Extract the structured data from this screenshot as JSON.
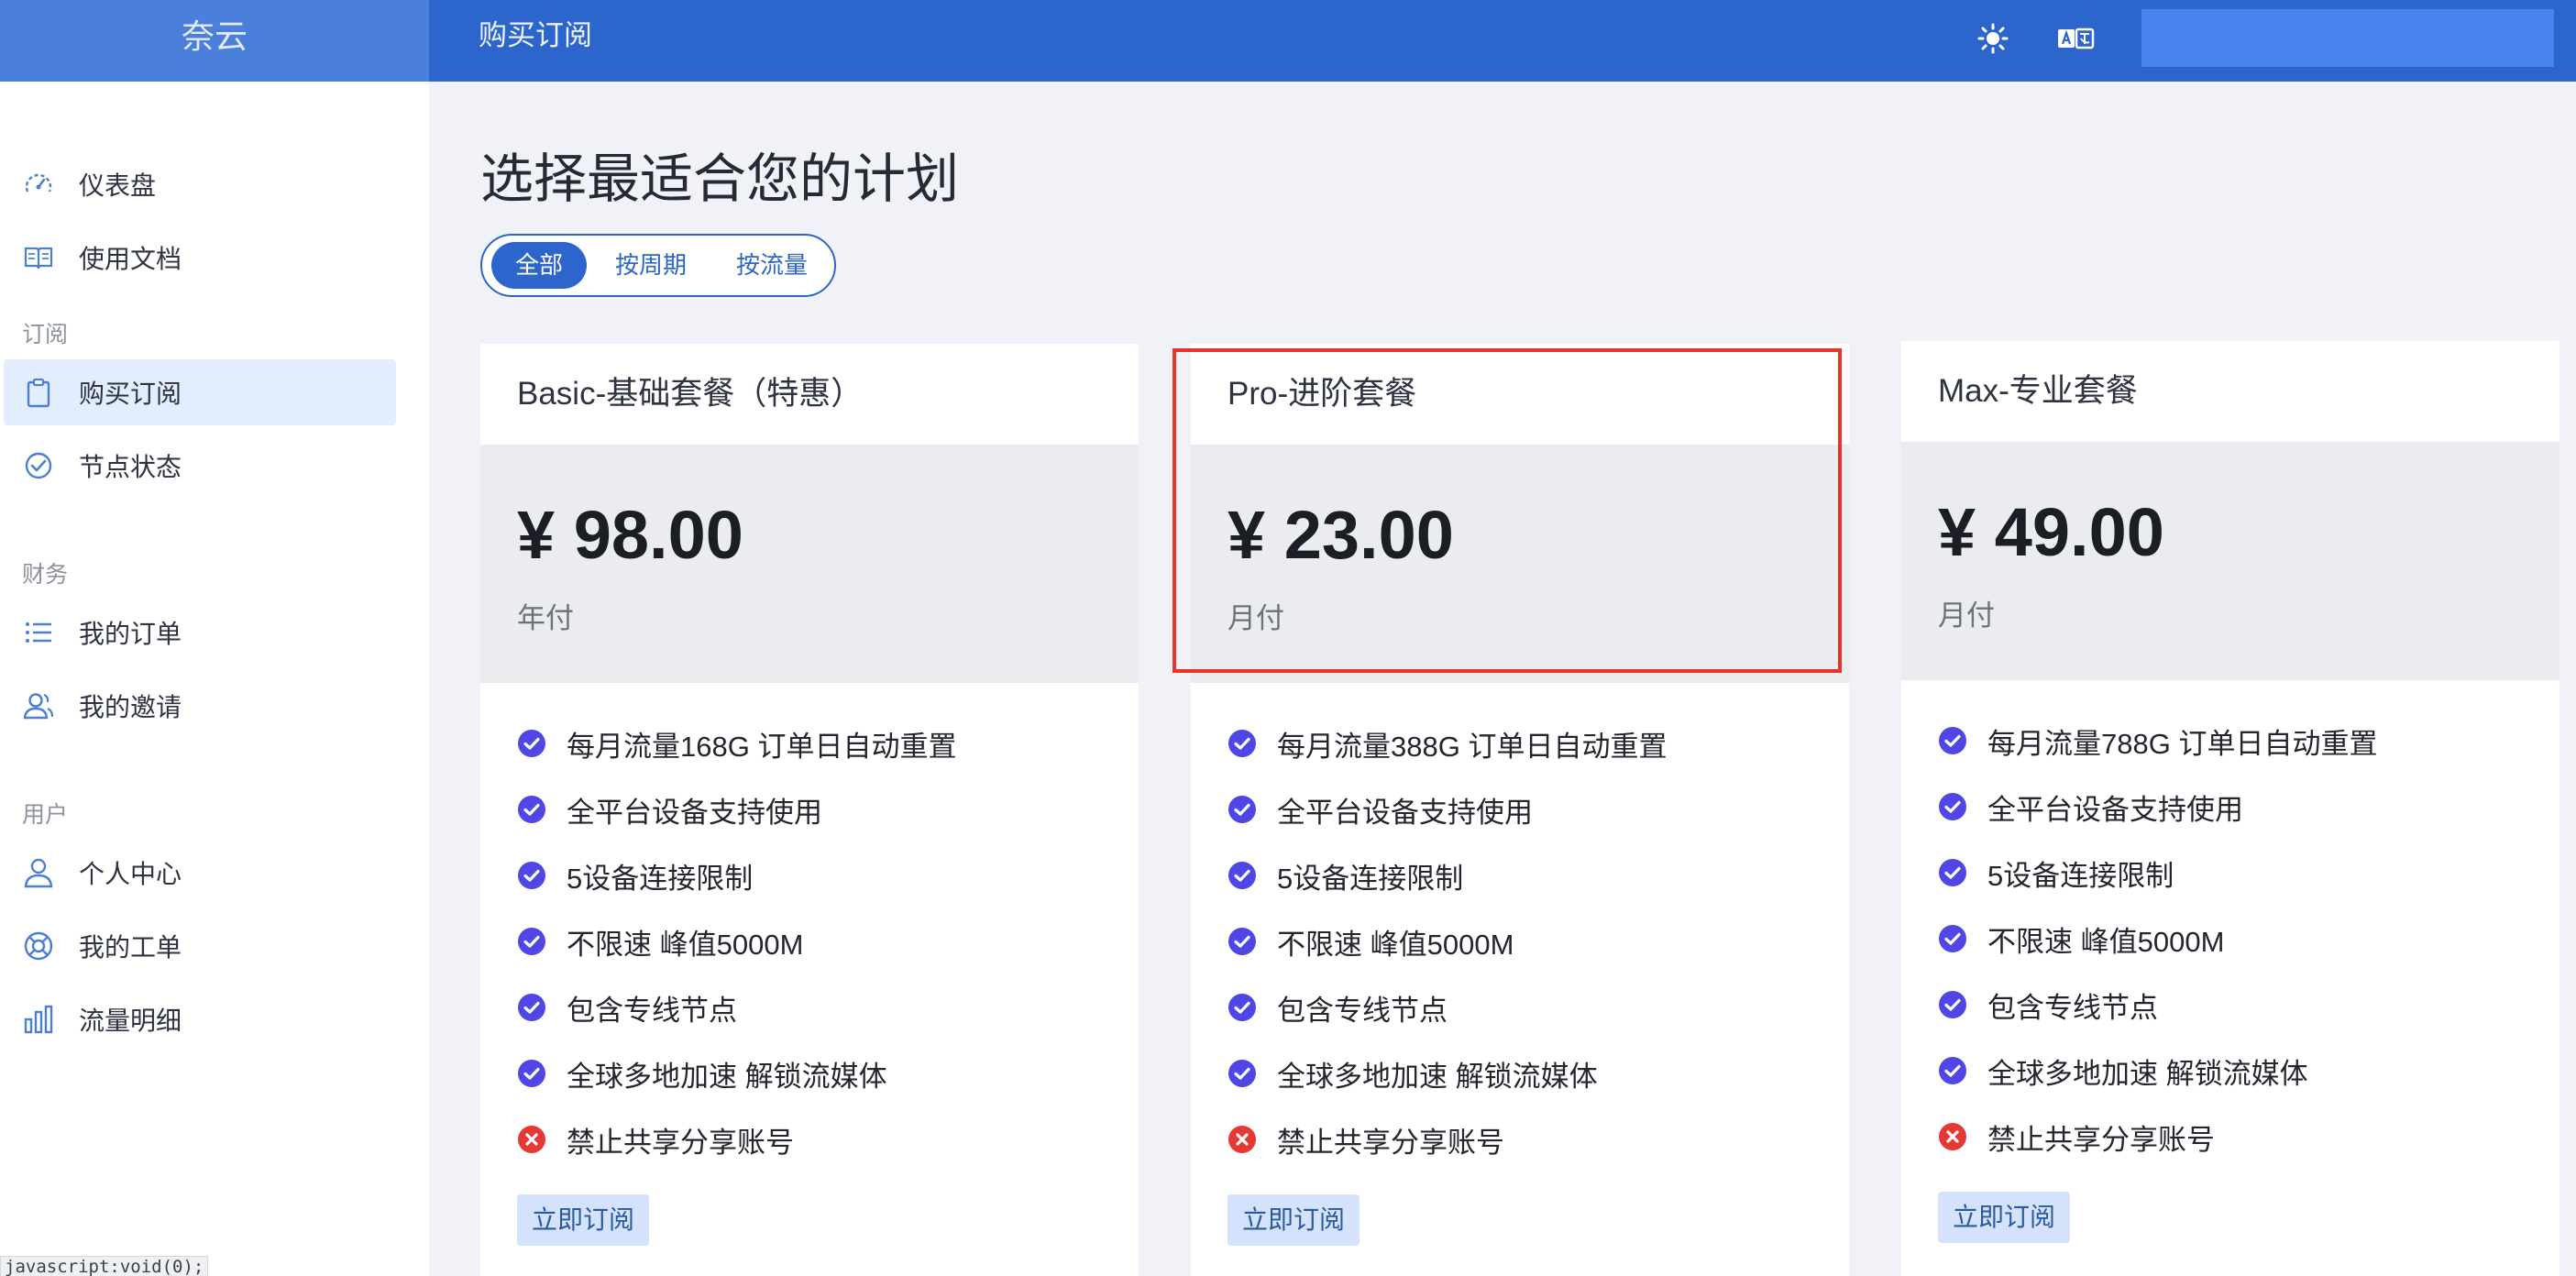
{
  "header": {
    "brand": "奈云",
    "page_title": "购买订阅"
  },
  "sidebar": {
    "items_top": [
      {
        "label": "仪表盘",
        "icon": "gauge-icon"
      },
      {
        "label": "使用文档",
        "icon": "book-icon"
      }
    ],
    "groups": [
      {
        "title": "订阅",
        "items": [
          {
            "label": "购买订阅",
            "icon": "clipboard-icon",
            "active": true
          },
          {
            "label": "节点状态",
            "icon": "check-circle-icon"
          }
        ]
      },
      {
        "title": "财务",
        "items": [
          {
            "label": "我的订单",
            "icon": "list-icon"
          },
          {
            "label": "我的邀请",
            "icon": "user-group-icon"
          }
        ]
      },
      {
        "title": "用户",
        "items": [
          {
            "label": "个人中心",
            "icon": "user-icon"
          },
          {
            "label": "我的工单",
            "icon": "lifebuoy-icon"
          },
          {
            "label": "流量明细",
            "icon": "bar-chart-icon"
          }
        ]
      }
    ]
  },
  "main": {
    "title": "选择最适合您的计划",
    "filters": [
      "全部",
      "按周期",
      "按流量"
    ],
    "active_filter": "全部"
  },
  "plans": [
    {
      "name": "Basic-基础套餐（特惠）",
      "price": "¥ 98.00",
      "period": "年付",
      "features": [
        {
          "text": "每月流量168G 订单日自动重置",
          "ok": true
        },
        {
          "text": "全平台设备支持使用",
          "ok": true
        },
        {
          "text": "5设备连接限制",
          "ok": true
        },
        {
          "text": "不限速 峰值5000M",
          "ok": true
        },
        {
          "text": "包含专线节点",
          "ok": true
        },
        {
          "text": "全球多地加速 解锁流媒体",
          "ok": true
        },
        {
          "text": "禁止共享分享账号",
          "ok": false
        }
      ],
      "button": "立即订阅"
    },
    {
      "name": "Pro-进阶套餐",
      "price": "¥ 23.00",
      "period": "月付",
      "features": [
        {
          "text": "每月流量388G 订单日自动重置",
          "ok": true
        },
        {
          "text": "全平台设备支持使用",
          "ok": true
        },
        {
          "text": "5设备连接限制",
          "ok": true
        },
        {
          "text": "不限速 峰值5000M",
          "ok": true
        },
        {
          "text": "包含专线节点",
          "ok": true
        },
        {
          "text": "全球多地加速 解锁流媒体",
          "ok": true
        },
        {
          "text": "禁止共享分享账号",
          "ok": false
        }
      ],
      "button": "立即订阅"
    },
    {
      "name": "Max-专业套餐",
      "price": "¥ 49.00",
      "period": "月付",
      "features": [
        {
          "text": "每月流量788G 订单日自动重置",
          "ok": true
        },
        {
          "text": "全平台设备支持使用",
          "ok": true
        },
        {
          "text": "5设备连接限制",
          "ok": true
        },
        {
          "text": "不限速 峰值5000M",
          "ok": true
        },
        {
          "text": "包含专线节点",
          "ok": true
        },
        {
          "text": "全球多地加速 解锁流媒体",
          "ok": true
        },
        {
          "text": "禁止共享分享账号",
          "ok": false
        }
      ],
      "button": "立即订阅"
    }
  ],
  "status_bar": {
    "text": "javascript:void(0);"
  },
  "colors": {
    "primary": "#2c66cc",
    "highlight": "#e8342a",
    "check": "#4f46e5",
    "cross": "#e53935"
  }
}
